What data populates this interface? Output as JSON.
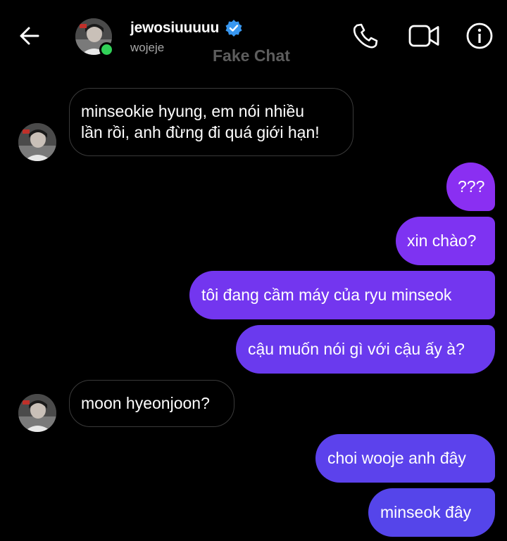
{
  "header": {
    "back_icon": "arrow-left-icon",
    "contact_name": "jewosiuuuuu",
    "username": "wojeje",
    "verified_icon": "verified-badge-icon",
    "watermark": "Fake Chat",
    "online_status_color": "#31d158",
    "call_icon": "phone-icon",
    "video_icon": "video-camera-icon",
    "info_icon": "info-icon"
  },
  "messages": [
    {
      "direction": "received",
      "lines": [
        "minseokie hyung, em nói nhiều",
        "lần rồi, anh đừng đi quá giới hạn!"
      ]
    },
    {
      "direction": "sent",
      "text": "???",
      "color": "#8a2ff2"
    },
    {
      "direction": "sent",
      "text": "xin chào?",
      "color": "#7e33f2"
    },
    {
      "direction": "sent",
      "text": "tôi đang cầm máy của ryu minseok",
      "color": "#7336ef"
    },
    {
      "direction": "sent",
      "text": "cậu muốn nói gì với cậu ấy à?",
      "color": "#6a3aee"
    },
    {
      "direction": "received",
      "text": "moon hyeonjoon?"
    },
    {
      "direction": "sent",
      "text": "choi wooje anh đây",
      "color": "#5c42ec"
    },
    {
      "direction": "sent",
      "text": "minseok đây",
      "color": "#5545ea"
    }
  ],
  "colors": {
    "background": "#000000",
    "verified_blue": "#3897f0",
    "received_border": "#3a3a3a"
  }
}
